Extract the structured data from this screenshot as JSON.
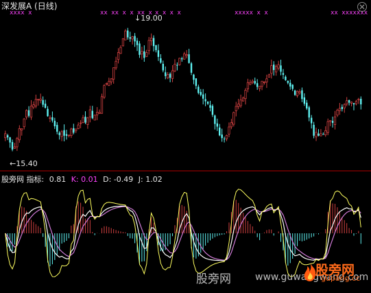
{
  "title": "深发展A (日线)",
  "high_marker": {
    "arrow": "↓",
    "text": "19.00"
  },
  "low_marker": {
    "arrow": "←",
    "text": "15.40"
  },
  "indicator": {
    "name": "股旁网 指标",
    "value_label": "0.81",
    "k_label": "K: 0.01",
    "d_label": "D: -0.49",
    "j_label": "J: 1.02"
  },
  "watermark": {
    "site_name": "股旁网",
    "site_url": "www.guwangwang.com",
    "brand": "股旁网",
    "brand_url": "gupang.cc"
  },
  "colors": {
    "background": "#000000",
    "up": "#d04040",
    "down": "#5ff2f2",
    "k_line": "#ffffff",
    "d_line": "#d27cd9",
    "j_line": "#ffff60",
    "signal": "#ff44ff",
    "separator": "#b00000"
  },
  "icons": [
    "close-icon",
    "fire-icon"
  ],
  "chart_data": {
    "type": "candlestick",
    "price_range": [
      15.0,
      19.4
    ],
    "high": 19.0,
    "low": 15.4,
    "indicator_range": [
      -1.6,
      1.6
    ],
    "closes": [
      15.92,
      15.81,
      15.66,
      15.45,
      15.53,
      15.78,
      16.07,
      16.07,
      16.36,
      16.61,
      16.45,
      16.74,
      16.78,
      16.94,
      16.94,
      16.95,
      16.78,
      16.69,
      16.44,
      16.39,
      16.31,
      16.14,
      15.98,
      15.88,
      15.98,
      15.86,
      15.86,
      15.88,
      16.06,
      15.95,
      16.06,
      16.18,
      16.24,
      16.39,
      16.25,
      16.39,
      16.63,
      16.38,
      16.47,
      16.56,
      16.55,
      17.02,
      17.35,
      17.41,
      17.47,
      17.55,
      17.88,
      18.07,
      18.33,
      18.48,
      18.74,
      18.97,
      18.78,
      18.74,
      18.8,
      18.66,
      18.55,
      18.26,
      18.36,
      18.17,
      18.33,
      18.69,
      18.76,
      18.52,
      18.4,
      18.2,
      18.03,
      17.8,
      17.63,
      17.68,
      17.58,
      17.79,
      17.98,
      17.96,
      18.16,
      18.13,
      18.29,
      18.27,
      18.02,
      17.73,
      17.52,
      17.34,
      17.13,
      17.07,
      16.96,
      16.88,
      16.81,
      16.69,
      16.48,
      16.21,
      16.13,
      15.87,
      15.79,
      15.76,
      15.87,
      16.12,
      16.25,
      16.55,
      16.73,
      16.8,
      16.92,
      16.98,
      17.21,
      17.44,
      17.44,
      17.48,
      17.41,
      17.31,
      17.33,
      17.48,
      17.46,
      17.55,
      17.67,
      17.94,
      17.81,
      17.92,
      17.97,
      17.76,
      17.67,
      17.51,
      17.43,
      17.32,
      17.25,
      17.07,
      17.18,
      17.17,
      16.95,
      16.81,
      16.67,
      16.4,
      16.23,
      15.86,
      15.96,
      15.86,
      15.92,
      15.89,
      16.01,
      16.28,
      16.31,
      16.24,
      16.42,
      16.62,
      16.67,
      16.65,
      16.79,
      16.9,
      16.84,
      16.86,
      16.79,
      16.88,
      16.94,
      16.79
    ],
    "signal_markers": [
      "xxxx  x",
      "xx xx x x xx  x",
      "x  x  x  x",
      "xxxxx  x x",
      "xx  xxxxxxx x"
    ]
  }
}
